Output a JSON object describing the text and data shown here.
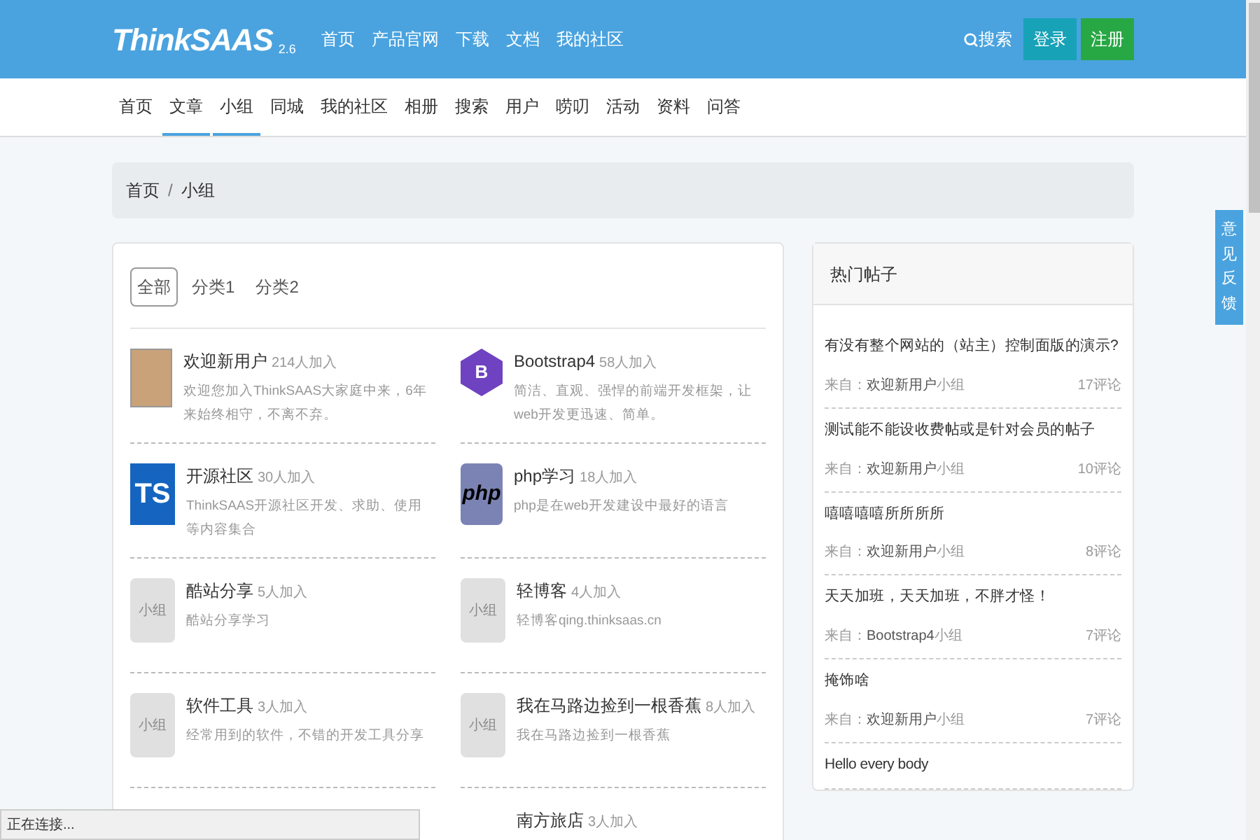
{
  "header": {
    "logo": "ThinkSAAS",
    "version": "2.6",
    "links": [
      "首页",
      "产品官网",
      "下载",
      "文档",
      "我的社区"
    ],
    "search": "搜索",
    "login": "登录",
    "register": "注册"
  },
  "subnav": [
    {
      "label": "首页",
      "selected": false
    },
    {
      "label": "文章",
      "selected": true
    },
    {
      "label": "小组",
      "selected": true
    },
    {
      "label": "同城",
      "selected": false
    },
    {
      "label": "我的社区",
      "selected": false
    },
    {
      "label": "相册",
      "selected": false
    },
    {
      "label": "搜索",
      "selected": false
    },
    {
      "label": "用户",
      "selected": false
    },
    {
      "label": "唠叨",
      "selected": false
    },
    {
      "label": "活动",
      "selected": false
    },
    {
      "label": "资料",
      "selected": false
    },
    {
      "label": "问答",
      "selected": false
    }
  ],
  "breadcrumb": [
    "首页",
    "小组"
  ],
  "breadcrumb_separator": "/",
  "filters": [
    {
      "label": "全部",
      "selected": true
    },
    {
      "label": "分类1",
      "selected": false
    },
    {
      "label": "分类2",
      "selected": false
    }
  ],
  "groups": [
    {
      "name": "欢迎新用户",
      "members": "214人加入",
      "desc": "欢迎您加入ThinkSAAS大家庭中来，6年来始终相守，不离不弃。",
      "avatar": {
        "kind": "photo"
      }
    },
    {
      "name": "Bootstrap4",
      "members": "58人加入",
      "desc": "简洁、直观、强悍的前端开发框架，让web开发更迅速、简单。",
      "avatar": {
        "kind": "hexagon",
        "text": "B"
      }
    },
    {
      "name": "开源社区",
      "members": "30人加入",
      "desc": "ThinkSAAS开源社区开发、求助、使用等内容集合",
      "avatar": {
        "kind": "ts",
        "text": "TS"
      }
    },
    {
      "name": "php学习",
      "members": "18人加入",
      "desc": "php是在web开发建设中最好的语言",
      "avatar": {
        "kind": "php",
        "text": "php"
      }
    },
    {
      "name": "酷站分享",
      "members": "5人加入",
      "desc": "酷站分享学习",
      "avatar": {
        "kind": "placeholder",
        "text": "小组"
      }
    },
    {
      "name": "轻博客",
      "members": "4人加入",
      "desc": "轻博客qing.thinksaas.cn",
      "avatar": {
        "kind": "placeholder",
        "text": "小组"
      }
    },
    {
      "name": "软件工具",
      "members": "3人加入",
      "desc": "经常用到的软件，不错的开发工具分享",
      "avatar": {
        "kind": "placeholder",
        "text": "小组"
      }
    },
    {
      "name": "我在马路边捡到一根香蕉",
      "members": "8人加入",
      "desc": "我在马路边捡到一根香蕉",
      "avatar": {
        "kind": "placeholder",
        "text": "小组"
      }
    },
    {
      "name": "南方旅店",
      "members": "3人加入",
      "avatar": {
        "kind": "none"
      }
    }
  ],
  "hot_posts": {
    "title": "热门帖子",
    "items": [
      {
        "title": "有没有整个网站的（站主）控制面版的演示?",
        "from": "来自：",
        "group": "欢迎新用户",
        "suffix": "小组",
        "comments": "17评论"
      },
      {
        "title": "测试能不能设收费帖或是针对会员的帖子",
        "from": "来自：",
        "group": "欢迎新用户",
        "suffix": "小组",
        "comments": "10评论"
      },
      {
        "title": "嘻嘻嘻嘻所所所所",
        "from": "来自：",
        "group": "欢迎新用户",
        "suffix": "小组",
        "comments": "8评论"
      },
      {
        "title": "天天加班，天天加班，不胖才怪！",
        "from": "来自：",
        "group": "Bootstrap4",
        "suffix": "小组",
        "comments": "7评论"
      },
      {
        "title": "掩饰啥",
        "from": "来自：",
        "group": "欢迎新用户",
        "suffix": "小组",
        "comments": "7评论"
      },
      {
        "title": "Hello every body"
      }
    ]
  },
  "feedback": "意见反馈",
  "status_bar": "正在连接..."
}
